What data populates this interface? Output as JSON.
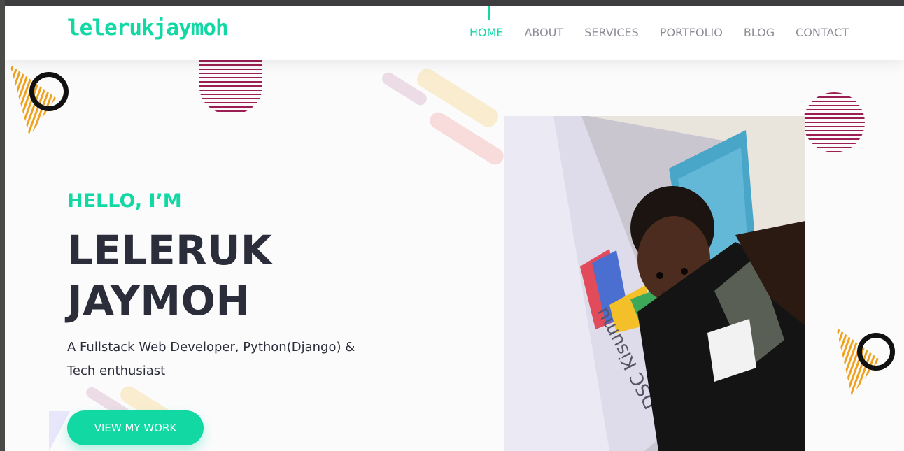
{
  "brand": {
    "logo_text": "lelerukjaymoh"
  },
  "nav": {
    "items": [
      {
        "label": "HOME",
        "active": true
      },
      {
        "label": "ABOUT",
        "active": false
      },
      {
        "label": "SERVICES",
        "active": false
      },
      {
        "label": "PORTFOLIO",
        "active": false
      },
      {
        "label": "BLOG",
        "active": false
      },
      {
        "label": "CONTACT",
        "active": false
      }
    ]
  },
  "hero": {
    "greeting": "HELLO, I’M",
    "name_line1": "LELERUK",
    "name_line2": "JAYMOH",
    "tagline": "A Fullstack Web Developer, Python(Django) & Tech enthusiast",
    "cta_label": "VIEW MY WORK"
  },
  "photo": {
    "banner_text": "DSC Kisumu"
  },
  "colors": {
    "accent": "#12d8a4",
    "heading": "#2c2d3a",
    "nav_text": "#8c8c96",
    "stripe": "#9b1f52",
    "orange": "#f0a21f"
  }
}
